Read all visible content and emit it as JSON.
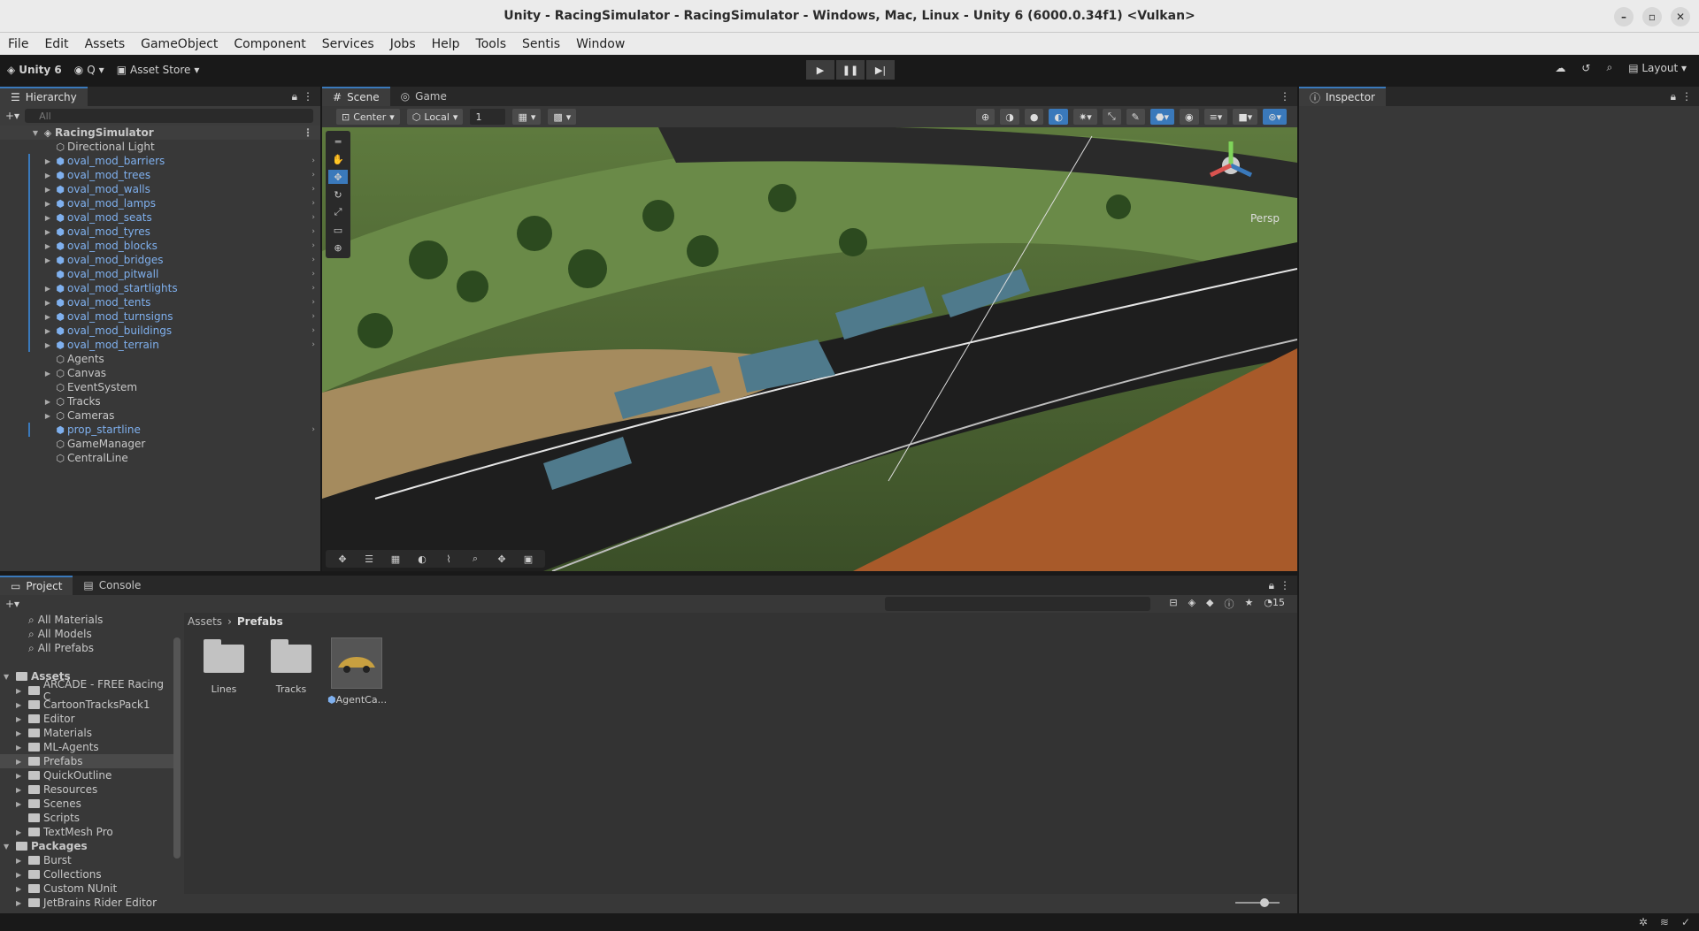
{
  "window": {
    "title": "Unity - RacingSimulator - RacingSimulator - Windows, Mac, Linux - Unity 6 (6000.0.34f1) <Vulkan>"
  },
  "menu": [
    "File",
    "Edit",
    "Assets",
    "GameObject",
    "Component",
    "Services",
    "Jobs",
    "Help",
    "Tools",
    "Sentis",
    "Window"
  ],
  "toolbar": {
    "unity_label": "Unity 6",
    "account_label": "Q",
    "asset_store_label": "Asset Store",
    "layout_label": "Layout"
  },
  "hierarchy": {
    "tab_label": "Hierarchy",
    "search_placeholder": "All",
    "scene_name": "RacingSimulator",
    "items": [
      {
        "label": "Directional Light"
      },
      {
        "label": "oval_mod_barriers"
      },
      {
        "label": "oval_mod_trees"
      },
      {
        "label": "oval_mod_walls"
      },
      {
        "label": "oval_mod_lamps"
      },
      {
        "label": "oval_mod_seats"
      },
      {
        "label": "oval_mod_tyres"
      },
      {
        "label": "oval_mod_blocks"
      },
      {
        "label": "oval_mod_bridges"
      },
      {
        "label": "oval_mod_pitwall"
      },
      {
        "label": "oval_mod_startlights"
      },
      {
        "label": "oval_mod_tents"
      },
      {
        "label": "oval_mod_turnsigns"
      },
      {
        "label": "oval_mod_buildings"
      },
      {
        "label": "oval_mod_terrain"
      },
      {
        "label": "Agents"
      },
      {
        "label": "Canvas"
      },
      {
        "label": "EventSystem"
      },
      {
        "label": "Tracks"
      },
      {
        "label": "Cameras"
      },
      {
        "label": "prop_startline"
      },
      {
        "label": "GameManager"
      },
      {
        "label": "CentralLine"
      }
    ]
  },
  "scene": {
    "tab_scene": "Scene",
    "tab_game": "Game",
    "pivot_label": "Center",
    "space_label": "Local",
    "grid_value": "1",
    "persp_label": "Persp"
  },
  "inspector": {
    "tab_label": "Inspector"
  },
  "project": {
    "tab_project": "Project",
    "tab_console": "Console",
    "hidden_count": "15",
    "favorites": [
      "All Materials",
      "All Models",
      "All Prefabs"
    ],
    "assets_root": "Assets",
    "asset_folders": [
      "ARCADE - FREE Racing C",
      "CartoonTracksPack1",
      "Editor",
      "Materials",
      "ML-Agents",
      "Prefabs",
      "QuickOutline",
      "Resources",
      "Scenes",
      "Scripts",
      "TextMesh Pro"
    ],
    "packages_root": "Packages",
    "package_folders": [
      "Burst",
      "Collections",
      "Custom NUnit",
      "JetBrains Rider Editor"
    ],
    "breadcrumb": [
      "Assets",
      "Prefabs"
    ],
    "items": [
      {
        "label": "Lines"
      },
      {
        "label": "Tracks"
      },
      {
        "label": "AgentCa..."
      }
    ]
  },
  "colors": {
    "accent": "#3a79bb",
    "prefab_text": "#7fb0ee"
  }
}
